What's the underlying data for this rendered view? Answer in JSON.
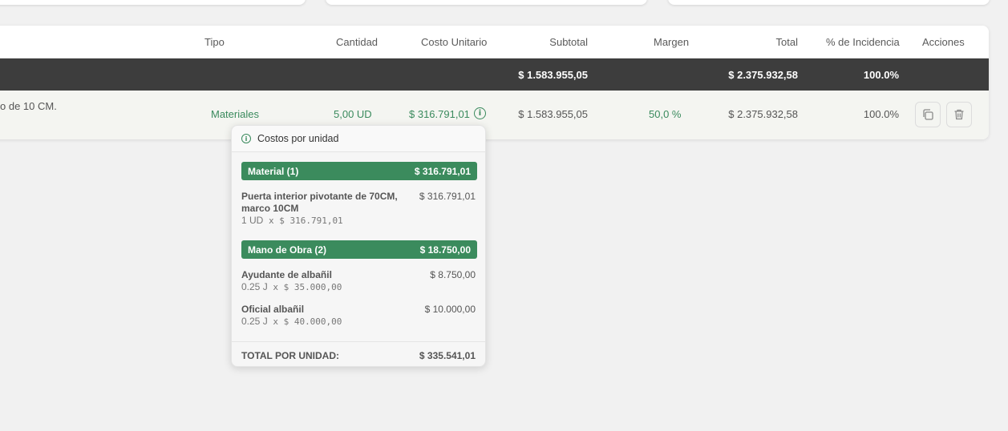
{
  "table": {
    "headers": {
      "tipo": "Tipo",
      "cantidad": "Cantidad",
      "costo_unitario": "Costo Unitario",
      "subtotal": "Subtotal",
      "margen": "Margen",
      "total": "Total",
      "incidencia": "% de Incidencia",
      "acciones": "Acciones"
    },
    "summary": {
      "subtotal": "$ 1.583.955,05",
      "total": "$ 2.375.932,58",
      "incidencia": "100.0%"
    },
    "row": {
      "descripcion": "o de 10 CM.",
      "tipo": "Materiales",
      "cantidad": "5,00 UD",
      "costo_unitario": "$ 316.791,01",
      "subtotal": "$ 1.583.955,05",
      "margen": "50,0 %",
      "total": "$ 2.375.932,58",
      "incidencia": "100.0%"
    }
  },
  "popover": {
    "title": "Costos por unidad",
    "groups": [
      {
        "label": "Material (1)",
        "value": "$ 316.791,01",
        "items": [
          {
            "name": "Puerta interior pivotante de 70CM, marco 10CM",
            "total": "$ 316.791,01",
            "qty": "1 UD",
            "formula": "x $ 316.791,01"
          }
        ]
      },
      {
        "label": "Mano de Obra (2)",
        "value": "$ 18.750,00",
        "items": [
          {
            "name": "Ayudante de albañil",
            "total": "$ 8.750,00",
            "qty": "0.25 J",
            "formula": "x $ 35.000,00"
          },
          {
            "name": "Oficial albañil",
            "total": "$ 10.000,00",
            "qty": "0.25 J",
            "formula": "x $ 40.000,00"
          }
        ]
      }
    ],
    "total_label": "TOTAL POR UNIDAD:",
    "total_value": "$ 335.541,01"
  },
  "colors": {
    "accent_green": "#3b8b5d",
    "summary_bg": "#3d3d3d"
  }
}
